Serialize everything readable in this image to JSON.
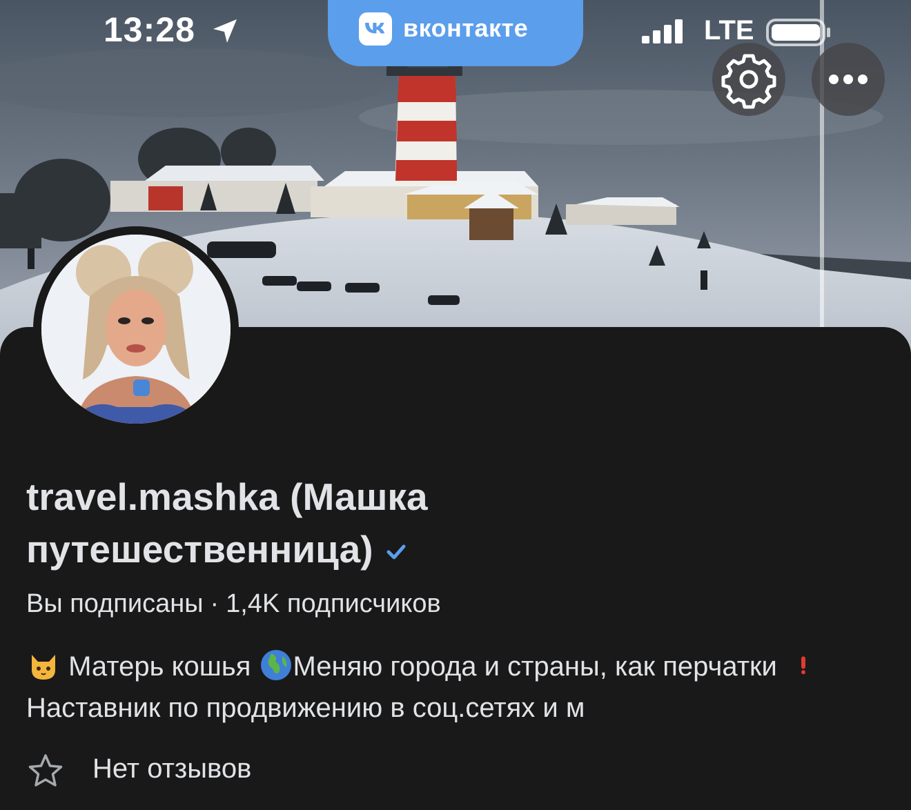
{
  "status_bar": {
    "time": "13:28",
    "network": "LTE",
    "location_icon": "location-arrow-icon",
    "signal_icon": "signal-icon",
    "battery_icon": "battery-icon"
  },
  "app_pill": {
    "label": "вконтакте",
    "logo_text": "VK",
    "color": "#5b9eeb"
  },
  "cover": {
    "description_icon": "cover-photo",
    "settings_icon": "gear-icon",
    "more_icon": "more-dots-icon"
  },
  "profile": {
    "name": "travel.mashka (Машка путешественница)",
    "verified_icon": "verified-check-icon",
    "subscription_status": "Вы подписаны",
    "separator": "·",
    "followers": "1,4K подписчиков",
    "bio": {
      "part1": "Матерь кошья",
      "part2": "Меняю города и страны, как перчатки",
      "part3": "Наставник по продвижению в соц.сетях и м"
    },
    "reviews": "Нет отзывов"
  },
  "colors": {
    "background": "#19191a",
    "text": "#e1e3e6",
    "accent": "#5b9eeb",
    "verified": "#5b9eeb"
  }
}
